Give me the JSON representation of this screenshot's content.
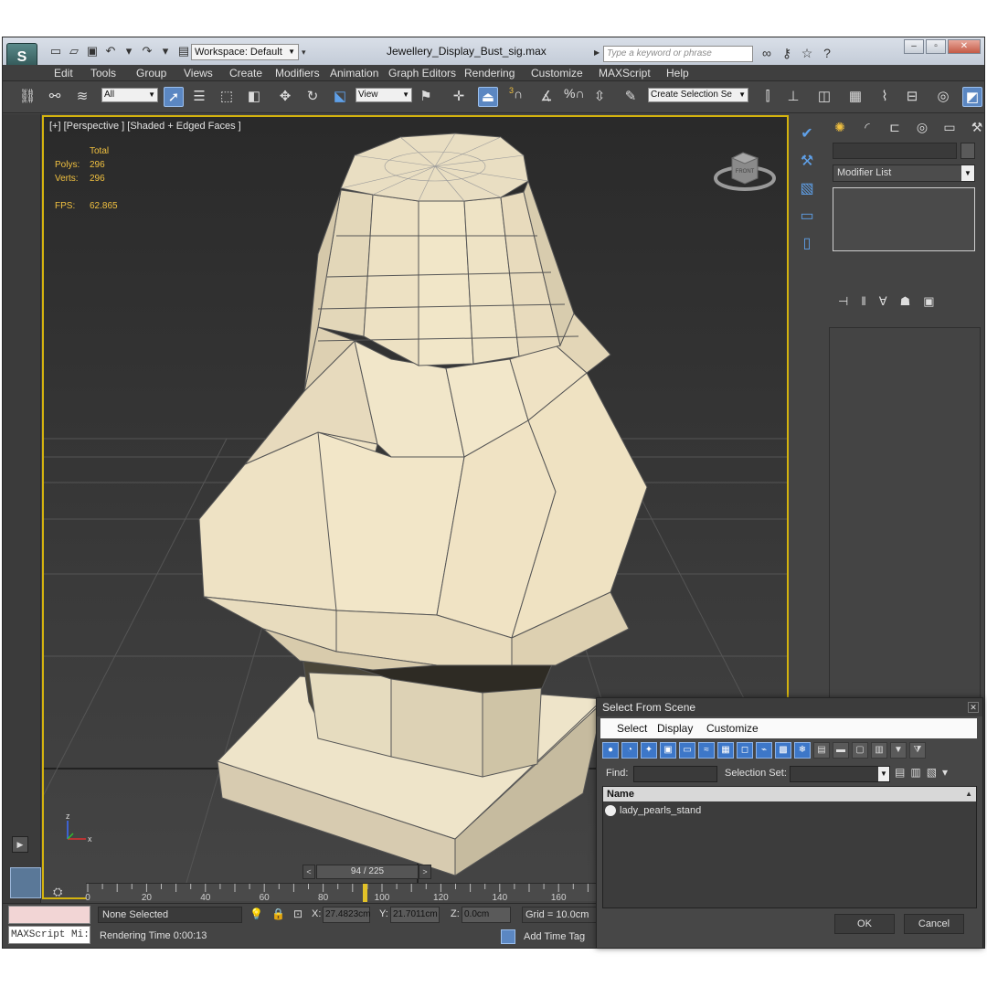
{
  "app": {
    "logo": "S",
    "workspace": "Workspace: Default",
    "document_title": "Jewellery_Display_Bust_sig.max",
    "search_placeholder": "Type a keyword or phrase",
    "quick_access_icons": [
      "new-icon",
      "open-icon",
      "save-icon",
      "undo-icon",
      "redo-icon",
      "project-folder-icon"
    ],
    "title_icons": [
      "binoculars-icon",
      "key-icon",
      "star-icon",
      "help-icon"
    ],
    "window_buttons": [
      "minimize",
      "restore",
      "close"
    ]
  },
  "menu": [
    "Edit",
    "Tools",
    "Group",
    "Views",
    "Create",
    "Modifiers",
    "Animation",
    "Graph Editors",
    "Rendering",
    "Customize",
    "MAXScript",
    "Help"
  ],
  "toolbar": {
    "selection_filter": "All",
    "reference_coord": "View",
    "selection_set_placeholder": "Create Selection Se",
    "snap_labels": [
      "3",
      "%"
    ]
  },
  "viewport": {
    "label": "[+] [Perspective ] [Shaded + Edged Faces ]",
    "stats": {
      "total_label": "Total",
      "polys_label": "Polys:",
      "polys_value": "296",
      "verts_label": "Verts:",
      "verts_value": "296",
      "fps_label": "FPS:",
      "fps_value": "62.865"
    },
    "viewcube_label": "FRONT",
    "axis_labels": [
      "z",
      "x"
    ]
  },
  "timeline": {
    "slider_text": "94 / 225",
    "current_frame": 94,
    "total_frames": 225,
    "ticks": [
      "0",
      "20",
      "40",
      "60",
      "80",
      "100",
      "120",
      "140",
      "160"
    ]
  },
  "status": {
    "selection": "None Selected",
    "x_label": "X:",
    "x_value": "27.4823cm",
    "y_label": "Y:",
    "y_value": "21.7011cm",
    "z_label": "Z:",
    "z_value": "0.0cm",
    "grid": "Grid = 10.0cm",
    "render_time": "Rendering Time  0:00:13",
    "add_time_tag": "Add Time Tag",
    "maxscript": "MAXScript Mi:"
  },
  "command_panel": {
    "modifier_list": "Modifier List",
    "tabs": [
      "create-icon",
      "modify-icon",
      "hierarchy-icon",
      "motion-icon",
      "display-icon",
      "utilities-icon"
    ]
  },
  "dialog": {
    "title": "Select From Scene",
    "menu": [
      "Select",
      "Display",
      "Customize"
    ],
    "find_label": "Find:",
    "selection_set_label": "Selection Set:",
    "column_name": "Name",
    "items": [
      "lady_pearls_stand"
    ],
    "ok": "OK",
    "cancel": "Cancel"
  }
}
